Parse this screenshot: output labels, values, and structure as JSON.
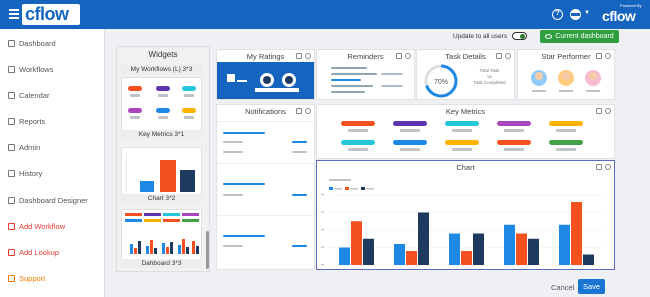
{
  "header": {
    "logo": "cflow",
    "powered_by": "Powered By",
    "brand": "cflow"
  },
  "sidebar": {
    "items": [
      {
        "label": "Dashboard",
        "icon": "home-icon"
      },
      {
        "label": "Workflows",
        "icon": "grid-icon"
      },
      {
        "label": "Calendar",
        "icon": "calendar-icon"
      },
      {
        "label": "Reports",
        "icon": "report-icon"
      },
      {
        "label": "Admin",
        "icon": "admin-icon"
      },
      {
        "label": "History",
        "icon": "history-icon"
      },
      {
        "label": "Dashboard Designer",
        "icon": "designer-icon"
      },
      {
        "label": "Add Workflow",
        "icon": "add-workflow-icon"
      },
      {
        "label": "Add Lookup",
        "icon": "add-lookup-icon"
      },
      {
        "label": "Support",
        "icon": "support-icon"
      }
    ]
  },
  "toolbar": {
    "update_label": "Update to all users",
    "current_dashboard_label": "Current dashboard"
  },
  "widgets": {
    "title": "Widgets",
    "items": [
      {
        "label": "My Workflows (L) 3*3"
      },
      {
        "label": "Key Metrics 3*1"
      },
      {
        "label": "Chart 3*2"
      },
      {
        "label": "Dahboard 3*3"
      }
    ]
  },
  "cards": {
    "my_ratings": "My Ratings",
    "reminders": "Reminders",
    "task_details": "Task Details",
    "star_performer": "Star Performer",
    "notifications": "Notifications",
    "key_metrics": "Key Metrics",
    "chart": "Chart"
  },
  "task_details": {
    "percent": "70%",
    "line1": "Total Task",
    "line2": "vs",
    "line3": "Task Completed"
  },
  "chart_data": {
    "type": "bar",
    "categories": [
      "1",
      "2",
      "3",
      "4",
      "5"
    ],
    "series": [
      {
        "values": [
          1.0,
          1.2,
          1.8,
          2.3,
          2.3
        ]
      },
      {
        "values": [
          2.5,
          0.8,
          0.8,
          1.8,
          3.6
        ]
      },
      {
        "values": [
          1.5,
          3.0,
          1.8,
          1.5,
          0.6
        ]
      }
    ],
    "colors": [
      "#1e88e5",
      "#f4511e",
      "#1e3a5f"
    ]
  },
  "widget_chart": {
    "colors": [
      "#1e88e5",
      "#f4511e",
      "#1e3a5f"
    ]
  },
  "colors": {
    "primary": "#1565c0",
    "success": "#2e9e3e",
    "save": "#1976d2"
  },
  "footer": {
    "cancel_label": "Cancel",
    "save_label": "Save"
  }
}
